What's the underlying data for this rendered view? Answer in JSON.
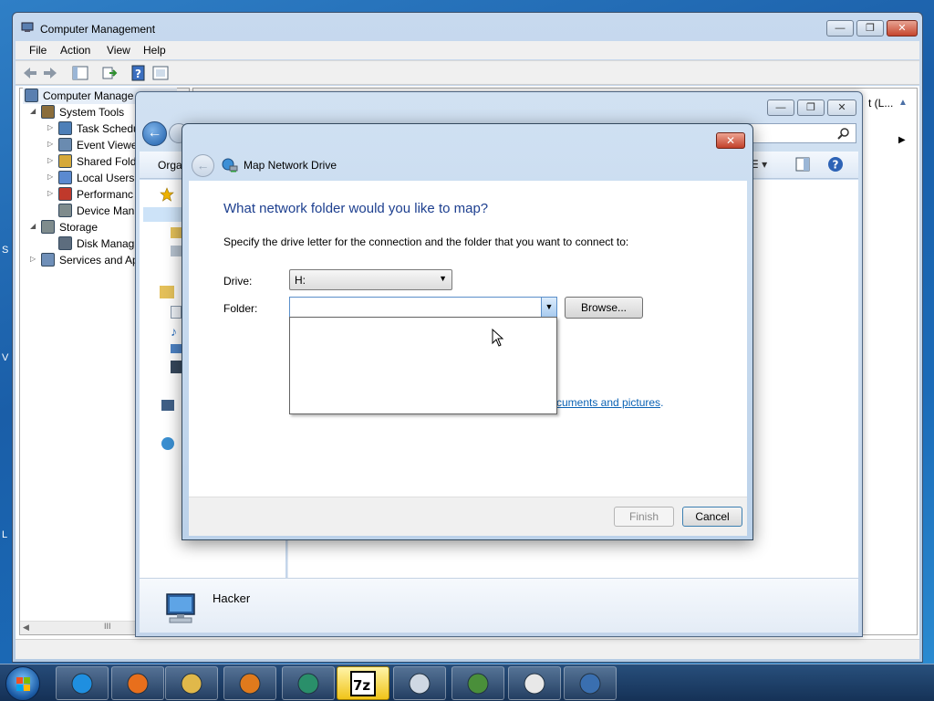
{
  "computer_management": {
    "title": "Computer Management",
    "menu": [
      "File",
      "Action",
      "View",
      "Help"
    ],
    "tree": [
      {
        "label": "Computer Manage",
        "level": 0,
        "twisty": "",
        "icon": "computer-management-icon"
      },
      {
        "label": "System Tools",
        "level": 1,
        "twisty": "◢",
        "icon": "tools-icon"
      },
      {
        "label": "Task Schedu",
        "level": 2,
        "twisty": "▷",
        "icon": "clock-icon"
      },
      {
        "label": "Event Viewe",
        "level": 2,
        "twisty": "▷",
        "icon": "event-viewer-icon"
      },
      {
        "label": "Shared Fold",
        "level": 2,
        "twisty": "▷",
        "icon": "shared-folder-icon"
      },
      {
        "label": "Local Users",
        "level": 2,
        "twisty": "▷",
        "icon": "users-icon"
      },
      {
        "label": "Performanc",
        "level": 2,
        "twisty": "▷",
        "icon": "performance-icon"
      },
      {
        "label": "Device Man",
        "level": 2,
        "twisty": "",
        "icon": "device-manager-icon"
      },
      {
        "label": "Storage",
        "level": 1,
        "twisty": "◢",
        "icon": "storage-icon"
      },
      {
        "label": "Disk Manag",
        "level": 2,
        "twisty": "",
        "icon": "disk-icon"
      },
      {
        "label": "Services and Ap",
        "level": 1,
        "twisty": "▷",
        "icon": "services-icon"
      }
    ],
    "right_header_fragment": "t (L...",
    "scroll_label": "III"
  },
  "explorer": {
    "organize_label": "Orga",
    "details_name": "Hacker"
  },
  "dialog": {
    "title": "Map Network Drive",
    "heading": "What network folder would you like to map?",
    "description": "Specify the drive letter for the connection and the folder that you want to connect to:",
    "drive_label": "Drive:",
    "drive_value": "H:",
    "folder_label": "Folder:",
    "folder_value": "",
    "browse_label": "Browse...",
    "link_partial": "cuments and pictures",
    "link_suffix": ".",
    "finish_label": "Finish",
    "cancel_label": "Cancel",
    "close_glyph": "✕"
  },
  "desktop": {
    "edge_fragments": [
      "S",
      "V",
      "L"
    ]
  },
  "taskbar": {
    "apps": [
      {
        "name": "internet-explorer",
        "active": false
      },
      {
        "name": "firefox",
        "active": false
      },
      {
        "name": "windows-explorer",
        "active": false
      },
      {
        "name": "media-player",
        "active": false
      },
      {
        "name": "chat-app",
        "active": false
      },
      {
        "name": "7zip",
        "active": true,
        "label": "7z"
      },
      {
        "name": "notepad",
        "active": false
      },
      {
        "name": "network-monitor",
        "active": false
      },
      {
        "name": "text-document",
        "active": false
      },
      {
        "name": "computer-management",
        "active": false
      }
    ]
  },
  "colors": {
    "heading_blue": "#1d3f8f",
    "link_blue": "#0a62b4",
    "close_red": "#c1402a",
    "taskbar_active": "#f0c419"
  }
}
